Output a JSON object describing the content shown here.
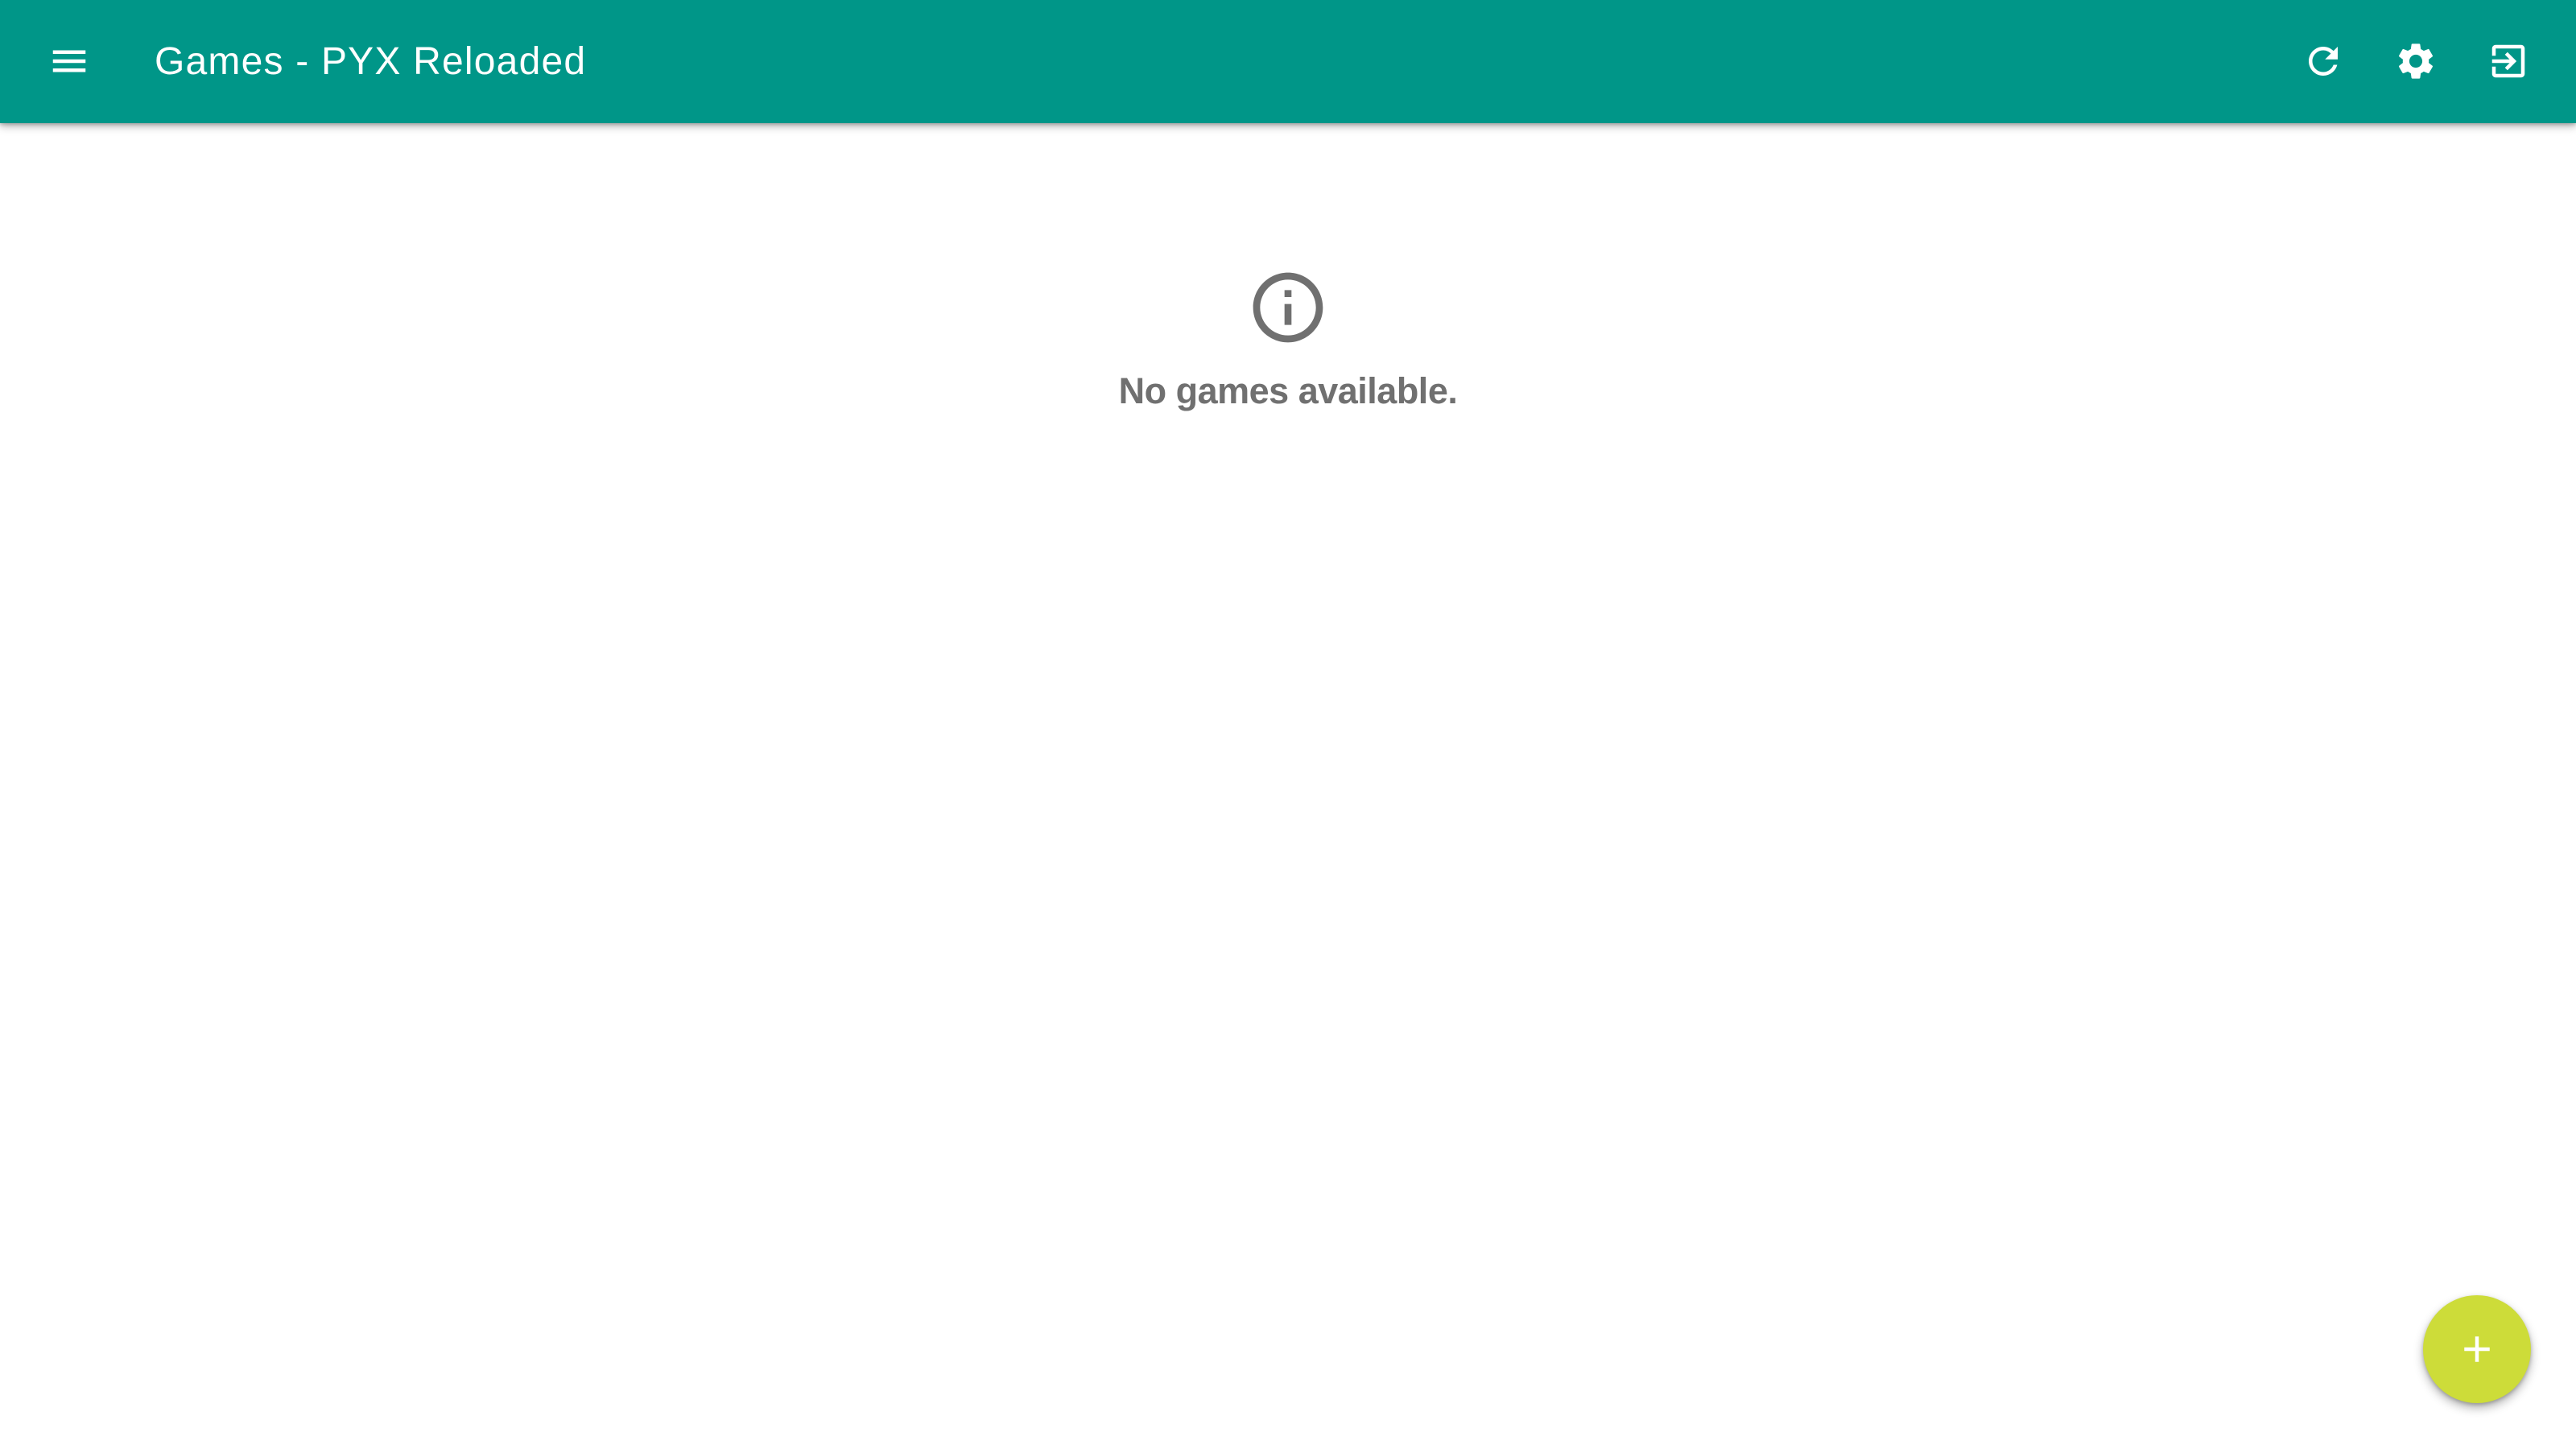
{
  "toolbar": {
    "title": "Games - PYX Reloaded",
    "background_color": "#009688",
    "icons": {
      "menu": "menu-icon",
      "refresh": "refresh-icon",
      "settings": "gear-icon",
      "logout": "logout-icon"
    }
  },
  "main": {
    "empty_state": {
      "icon": "info-icon",
      "message": "No games available.",
      "text_color": "#707070"
    }
  },
  "fab": {
    "icon": "plus-icon",
    "color": "#cddc39"
  }
}
